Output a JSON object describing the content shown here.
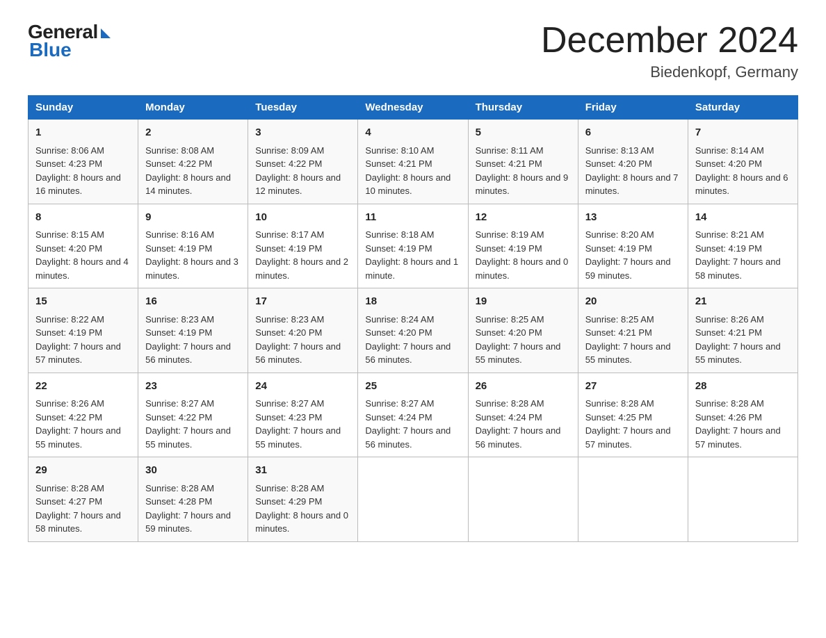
{
  "header": {
    "logo_general": "General",
    "logo_blue": "Blue",
    "month_title": "December 2024",
    "location": "Biedenkopf, Germany"
  },
  "days_of_week": [
    "Sunday",
    "Monday",
    "Tuesday",
    "Wednesday",
    "Thursday",
    "Friday",
    "Saturday"
  ],
  "weeks": [
    [
      {
        "day": "1",
        "sunrise": "8:06 AM",
        "sunset": "4:23 PM",
        "daylight": "8 hours and 16 minutes."
      },
      {
        "day": "2",
        "sunrise": "8:08 AM",
        "sunset": "4:22 PM",
        "daylight": "8 hours and 14 minutes."
      },
      {
        "day": "3",
        "sunrise": "8:09 AM",
        "sunset": "4:22 PM",
        "daylight": "8 hours and 12 minutes."
      },
      {
        "day": "4",
        "sunrise": "8:10 AM",
        "sunset": "4:21 PM",
        "daylight": "8 hours and 10 minutes."
      },
      {
        "day": "5",
        "sunrise": "8:11 AM",
        "sunset": "4:21 PM",
        "daylight": "8 hours and 9 minutes."
      },
      {
        "day": "6",
        "sunrise": "8:13 AM",
        "sunset": "4:20 PM",
        "daylight": "8 hours and 7 minutes."
      },
      {
        "day": "7",
        "sunrise": "8:14 AM",
        "sunset": "4:20 PM",
        "daylight": "8 hours and 6 minutes."
      }
    ],
    [
      {
        "day": "8",
        "sunrise": "8:15 AM",
        "sunset": "4:20 PM",
        "daylight": "8 hours and 4 minutes."
      },
      {
        "day": "9",
        "sunrise": "8:16 AM",
        "sunset": "4:19 PM",
        "daylight": "8 hours and 3 minutes."
      },
      {
        "day": "10",
        "sunrise": "8:17 AM",
        "sunset": "4:19 PM",
        "daylight": "8 hours and 2 minutes."
      },
      {
        "day": "11",
        "sunrise": "8:18 AM",
        "sunset": "4:19 PM",
        "daylight": "8 hours and 1 minute."
      },
      {
        "day": "12",
        "sunrise": "8:19 AM",
        "sunset": "4:19 PM",
        "daylight": "8 hours and 0 minutes."
      },
      {
        "day": "13",
        "sunrise": "8:20 AM",
        "sunset": "4:19 PM",
        "daylight": "7 hours and 59 minutes."
      },
      {
        "day": "14",
        "sunrise": "8:21 AM",
        "sunset": "4:19 PM",
        "daylight": "7 hours and 58 minutes."
      }
    ],
    [
      {
        "day": "15",
        "sunrise": "8:22 AM",
        "sunset": "4:19 PM",
        "daylight": "7 hours and 57 minutes."
      },
      {
        "day": "16",
        "sunrise": "8:23 AM",
        "sunset": "4:19 PM",
        "daylight": "7 hours and 56 minutes."
      },
      {
        "day": "17",
        "sunrise": "8:23 AM",
        "sunset": "4:20 PM",
        "daylight": "7 hours and 56 minutes."
      },
      {
        "day": "18",
        "sunrise": "8:24 AM",
        "sunset": "4:20 PM",
        "daylight": "7 hours and 56 minutes."
      },
      {
        "day": "19",
        "sunrise": "8:25 AM",
        "sunset": "4:20 PM",
        "daylight": "7 hours and 55 minutes."
      },
      {
        "day": "20",
        "sunrise": "8:25 AM",
        "sunset": "4:21 PM",
        "daylight": "7 hours and 55 minutes."
      },
      {
        "day": "21",
        "sunrise": "8:26 AM",
        "sunset": "4:21 PM",
        "daylight": "7 hours and 55 minutes."
      }
    ],
    [
      {
        "day": "22",
        "sunrise": "8:26 AM",
        "sunset": "4:22 PM",
        "daylight": "7 hours and 55 minutes."
      },
      {
        "day": "23",
        "sunrise": "8:27 AM",
        "sunset": "4:22 PM",
        "daylight": "7 hours and 55 minutes."
      },
      {
        "day": "24",
        "sunrise": "8:27 AM",
        "sunset": "4:23 PM",
        "daylight": "7 hours and 55 minutes."
      },
      {
        "day": "25",
        "sunrise": "8:27 AM",
        "sunset": "4:24 PM",
        "daylight": "7 hours and 56 minutes."
      },
      {
        "day": "26",
        "sunrise": "8:28 AM",
        "sunset": "4:24 PM",
        "daylight": "7 hours and 56 minutes."
      },
      {
        "day": "27",
        "sunrise": "8:28 AM",
        "sunset": "4:25 PM",
        "daylight": "7 hours and 57 minutes."
      },
      {
        "day": "28",
        "sunrise": "8:28 AM",
        "sunset": "4:26 PM",
        "daylight": "7 hours and 57 minutes."
      }
    ],
    [
      {
        "day": "29",
        "sunrise": "8:28 AM",
        "sunset": "4:27 PM",
        "daylight": "7 hours and 58 minutes."
      },
      {
        "day": "30",
        "sunrise": "8:28 AM",
        "sunset": "4:28 PM",
        "daylight": "7 hours and 59 minutes."
      },
      {
        "day": "31",
        "sunrise": "8:28 AM",
        "sunset": "4:29 PM",
        "daylight": "8 hours and 0 minutes."
      },
      null,
      null,
      null,
      null
    ]
  ]
}
